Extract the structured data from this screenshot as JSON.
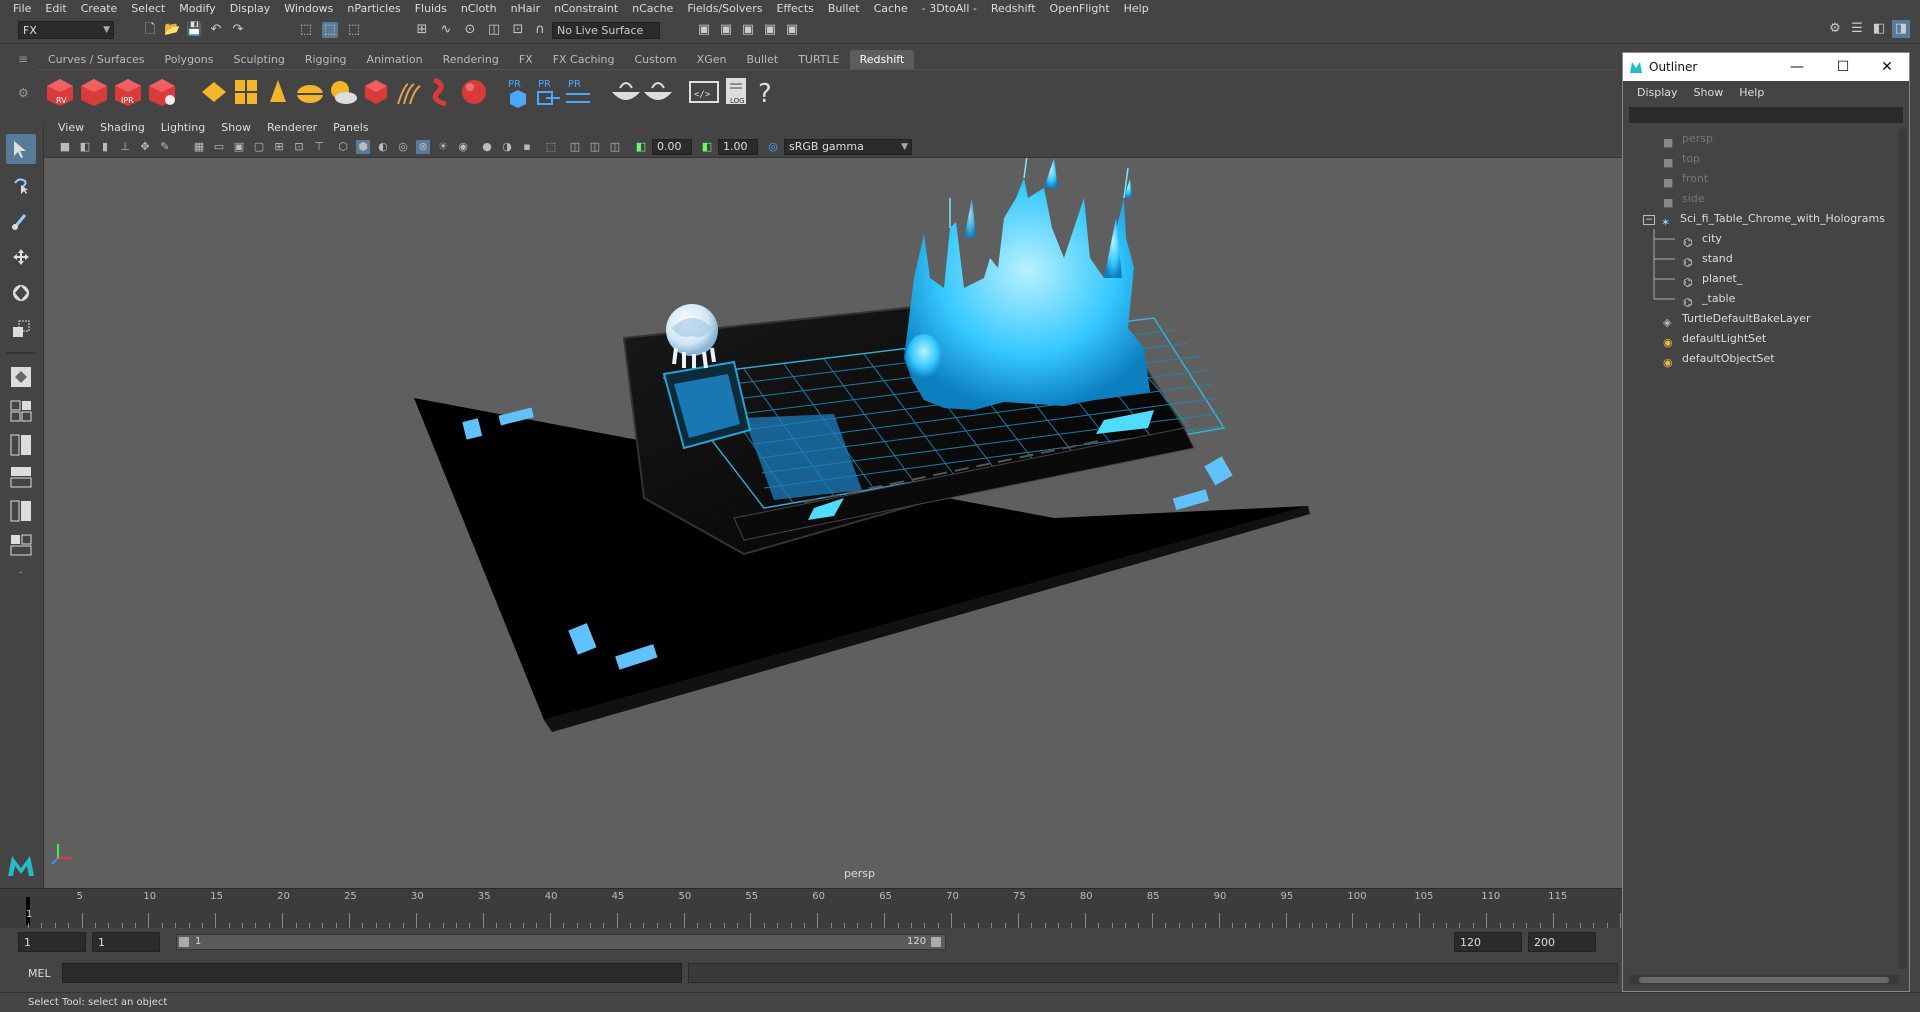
{
  "menubar": {
    "items": [
      "File",
      "Edit",
      "Create",
      "Select",
      "Modify",
      "Display",
      "Windows",
      "nParticles",
      "Fluids",
      "nCloth",
      "nHair",
      "nConstraint",
      "nCache",
      "Fields/Solvers",
      "Effects",
      "Bullet",
      "Cache",
      "- 3DtoAll -",
      "Redshift",
      "OpenFlight",
      "Help"
    ]
  },
  "statusline": {
    "mode": "FX",
    "live_surface": "No Live Surface"
  },
  "shelf": {
    "tabs": [
      "Curves / Surfaces",
      "Polygons",
      "Sculpting",
      "Rigging",
      "Animation",
      "Rendering",
      "FX",
      "FX Caching",
      "Custom",
      "XGen",
      "Bullet",
      "TURTLE",
      "Redshift"
    ],
    "active_tab": "Redshift",
    "icon_labels": [
      "RV",
      "IPR",
      "PR",
      "PR",
      "PR",
      "LOG",
      "?"
    ]
  },
  "panel": {
    "menu": [
      "View",
      "Shading",
      "Lighting",
      "Show",
      "Renderer",
      "Panels"
    ],
    "exposure": "0.00",
    "gamma": "1.00",
    "color_space": "sRGB gamma",
    "camera_label": "persp"
  },
  "timeline": {
    "ticks": [
      "5",
      "10",
      "15",
      "20",
      "25",
      "30",
      "35",
      "40",
      "45",
      "50",
      "55",
      "60",
      "65",
      "70",
      "75",
      "80",
      "85",
      "90",
      "95",
      "100",
      "105",
      "110",
      "115"
    ],
    "current_frame_marker": "1"
  },
  "range": {
    "start_frame": "1",
    "playback_start": "1",
    "slider_start": "1",
    "slider_end": "120",
    "playback_end": "120",
    "end_frame": "200"
  },
  "cmdline": {
    "label": "MEL"
  },
  "helpline": {
    "text": "Select Tool: select an object"
  },
  "outliner": {
    "title": "Outliner",
    "menu": [
      "Display",
      "Show",
      "Help"
    ],
    "items": [
      {
        "label": "persp",
        "dim": true
      },
      {
        "label": "top",
        "dim": true
      },
      {
        "label": "front",
        "dim": true
      },
      {
        "label": "side",
        "dim": true
      },
      {
        "label": "Sci_fi_Table_Chrome_with_Holograms",
        "dim": false
      },
      {
        "label": "city",
        "dim": false
      },
      {
        "label": "stand",
        "dim": false
      },
      {
        "label": "planet_",
        "dim": false
      },
      {
        "label": "_table",
        "dim": false
      },
      {
        "label": "TurtleDefaultBakeLayer",
        "dim": false
      },
      {
        "label": "defaultLightSet",
        "dim": false
      },
      {
        "label": "defaultObjectSet",
        "dim": false
      }
    ]
  },
  "colors": {
    "hologram": "#35c8ff",
    "shelf_red": "#d93a3a",
    "active_blue": "#5a7a99"
  }
}
